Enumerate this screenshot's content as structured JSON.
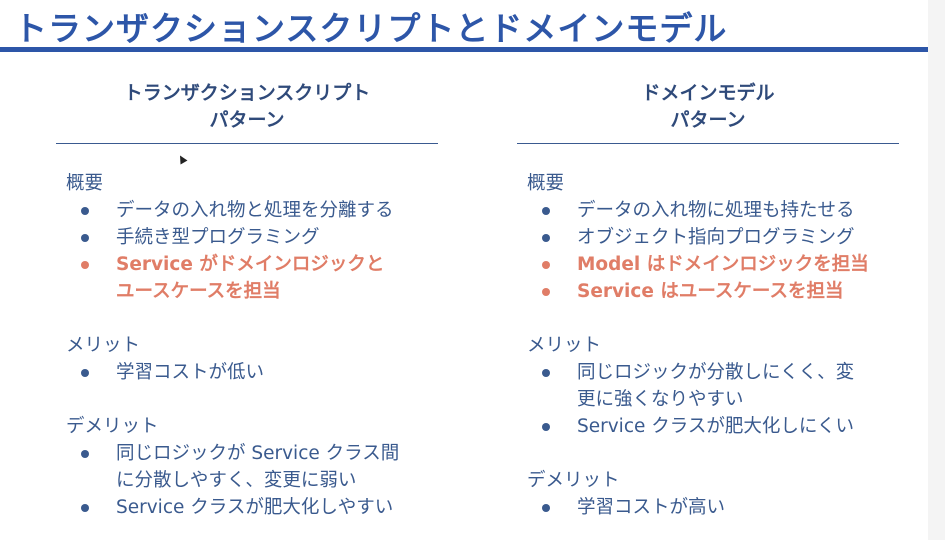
{
  "title": "トランザクションスクリプトとドメインモデル",
  "left": {
    "heading_line1": "トランザクションスクリプト",
    "heading_line2": "パターン",
    "overview_title": "概要",
    "overview": [
      "データの入れ物と処理を分離する",
      "手続き型プログラミング",
      "Service がドメインロジックと\nユースケースを担当"
    ],
    "merit_title": "メリット",
    "merits": [
      "学習コストが低い"
    ],
    "demerit_title": "デメリット",
    "demerits": [
      "同じロジックが Service クラス間\nに分散しやすく、変更に弱い",
      "Service クラスが肥大化しやすい"
    ]
  },
  "right": {
    "heading_line1": "ドメインモデル",
    "heading_line2": "パターン",
    "overview_title": "概要",
    "overview": [
      "データの入れ物に処理も持たせる",
      "オブジェクト指向プログラミング",
      "Model はドメインロジックを担当",
      "Service はユースケースを担当"
    ],
    "merit_title": "メリット",
    "merits": [
      "同じロジックが分散しにくく、変\n更に強くなりやすい",
      "Service クラスが肥大化しにくい"
    ],
    "demerit_title": "デメリット",
    "demerits": [
      "学習コストが高い"
    ]
  },
  "colors": {
    "title": "#2d56a8",
    "text": "#3a5a8e",
    "highlight": "#e07d67"
  }
}
